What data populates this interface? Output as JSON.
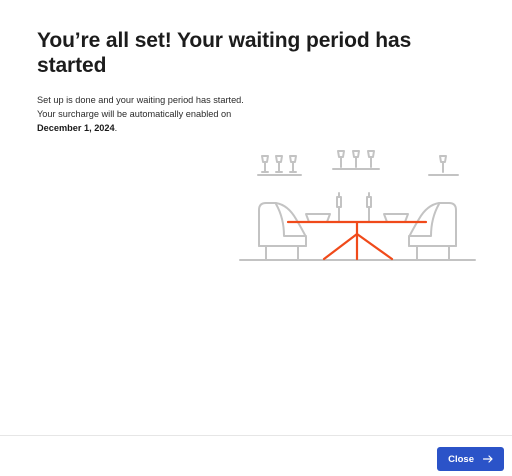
{
  "heading": "You’re all set! Your waiting period has started",
  "description": {
    "line1": "Set up is done and your waiting period has started.",
    "line2": "Your surcharge will be automatically enabled on",
    "date": "December 1, 2024",
    "suffix": "."
  },
  "footer": {
    "close_label": "Close",
    "close_icon": "arrow-right-icon"
  },
  "colors": {
    "accent": "#2b53c8",
    "illustration_line": "#c3c3c3",
    "illustration_highlight": "#f04a1a"
  }
}
